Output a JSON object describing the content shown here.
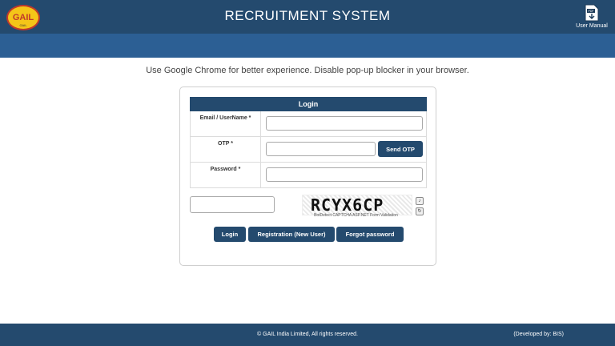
{
  "header": {
    "logo_text": "GAIL",
    "logo_sub": "GAIL",
    "title": "RECRUITMENT SYSTEM",
    "user_manual_label": "User Manual",
    "user_manual_icon": "pdf-download-icon"
  },
  "notice": "Use Google Chrome for better experience. Disable pop-up blocker in your browser.",
  "login": {
    "heading": "Login",
    "email_label": "Email / UserName *",
    "email_value": "",
    "otp_label": "OTP *",
    "otp_value": "",
    "send_otp_label": "Send OTP",
    "password_label": "Password *",
    "password_value": "",
    "captcha_input_value": "",
    "captcha_text": "RCYX6CP",
    "captcha_note": "BotDetect CAPTCHA ASP.NET Form Validation",
    "login_button": "Login",
    "register_button": "Registration (New User)",
    "forgot_button": "Forgot password"
  },
  "footer": {
    "copyright": "© GAIL India Limited, All rights reserved.",
    "developer": "(Developed by: BIS)"
  },
  "colors": {
    "header": "#244a6e",
    "subbar": "#2c5f94",
    "button": "#244a6e"
  }
}
